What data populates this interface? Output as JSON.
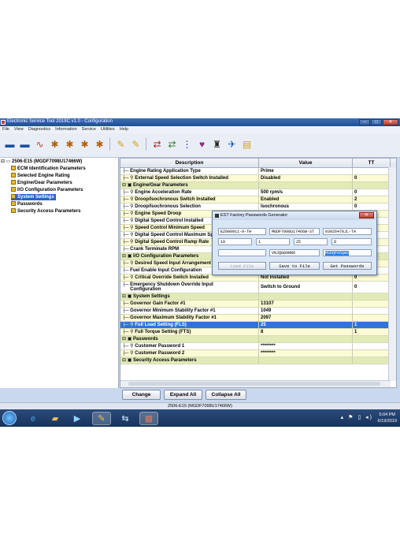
{
  "window": {
    "title": "Electronic Service Tool 2019C v1.0 - Configuration"
  },
  "menu": [
    "File",
    "View",
    "Diagnostics",
    "Information",
    "Service",
    "Utilities",
    "Help"
  ],
  "tree": [
    {
      "label": "2506-E15 (MGDF7098U17466W)",
      "level": 0
    },
    {
      "label": "ECM Identification Parameters",
      "level": 1
    },
    {
      "label": "Selected Engine Rating",
      "level": 1
    },
    {
      "label": "Engine/Gear Parameters",
      "level": 1
    },
    {
      "label": "I/O Configuration Parameters",
      "level": 1
    },
    {
      "label": "System Settings",
      "level": 1,
      "selected": true
    },
    {
      "label": "Passwords",
      "level": 1
    },
    {
      "label": "Security Access Parameters",
      "level": 1
    }
  ],
  "grid": {
    "headers": [
      "Description",
      "Value",
      "TT"
    ],
    "rows": [
      {
        "d": "Engine Rating Application Type",
        "v": "Prime",
        "t": "",
        "c": "w",
        "i": 1
      },
      {
        "d": "External Speed Selection Switch Installed",
        "v": "Disabled",
        "t": "0",
        "c": "y",
        "i": 2
      },
      {
        "d": "Engine/Gear Parameters",
        "v": "",
        "t": "",
        "c": "g",
        "i": 0
      },
      {
        "d": "Engine Acceleration Rate",
        "v": "500 rpm/s",
        "t": "0",
        "c": "w",
        "i": 2
      },
      {
        "d": "Droop/Isochronous Switch Installed",
        "v": "Enabled",
        "t": "2",
        "c": "y",
        "i": 2
      },
      {
        "d": "Droop/Isochronous Selection",
        "v": "Isochronous",
        "t": "0",
        "c": "w",
        "i": 2
      },
      {
        "d": "Engine Speed Droop",
        "v": "",
        "t": "",
        "c": "y",
        "i": 2
      },
      {
        "d": "Digital Speed Control Installed",
        "v": "",
        "t": "",
        "c": "w",
        "i": 2
      },
      {
        "d": "Speed Control Minimum Speed",
        "v": "",
        "t": "",
        "c": "y",
        "i": 2
      },
      {
        "d": "Digital Speed Control Maximum Speed",
        "v": "",
        "t": "",
        "c": "w",
        "i": 2
      },
      {
        "d": "Digital Speed Control Ramp Rate",
        "v": "",
        "t": "",
        "c": "y",
        "i": 2
      },
      {
        "d": "Crank Terminate RPM",
        "v": "",
        "t": "",
        "c": "w",
        "i": 1
      },
      {
        "d": "I/O Configuration Parameters",
        "v": "",
        "t": "",
        "c": "g",
        "i": 0
      },
      {
        "d": "Desired Speed Input Arrangement",
        "v": "",
        "t": "",
        "c": "y",
        "i": 2
      },
      {
        "d": "Fuel Enable Input Configuration",
        "v": "Switch to Ground",
        "t": "0",
        "c": "w",
        "i": 1
      },
      {
        "d": "Critical Override Switch Installed",
        "v": "Not Installed",
        "t": "0",
        "c": "y",
        "i": 2
      },
      {
        "d": "Emergency Shutdown Override Input Configuration",
        "v": "Switch to Ground",
        "t": "0",
        "c": "w",
        "i": 1,
        "tall": true
      },
      {
        "d": "System Settings",
        "v": "",
        "t": "",
        "c": "g",
        "i": 0
      },
      {
        "d": "Governor Gain Factor #1",
        "v": "13107",
        "t": "",
        "c": "y",
        "i": 1
      },
      {
        "d": "Governor Minimum Stability Factor #1",
        "v": "1049",
        "t": "",
        "c": "w",
        "i": 1
      },
      {
        "d": "Governor Maximum Stability Factor #1",
        "v": "2097",
        "t": "",
        "c": "y",
        "i": 1
      },
      {
        "d": "Full Load Setting (FLS)",
        "v": "25",
        "t": "1",
        "c": "s",
        "i": 2
      },
      {
        "d": "Full Torque Setting (FTS)",
        "v": "8",
        "t": "1",
        "c": "y",
        "i": 2
      },
      {
        "d": "Passwords",
        "v": "",
        "t": "",
        "c": "g",
        "i": 0
      },
      {
        "d": "Customer Password 1",
        "v": "********",
        "t": "",
        "c": "w",
        "i": 2
      },
      {
        "d": "Customer Password 2",
        "v": "********",
        "t": "",
        "c": "y",
        "i": 2
      },
      {
        "d": "Security Access Parameters",
        "v": "",
        "t": "",
        "c": "g",
        "i": 0
      }
    ]
  },
  "buttons": {
    "change": "Change",
    "expand": "Expand All",
    "collapse": "Collapse All"
  },
  "status": "2506-E15 (MGDF7098U17466W)",
  "dialog": {
    "title": "EST Factory Passwords Generator",
    "serial": "EZ000911-9-TH",
    "ecm": "MGDF7098U17466W-ST",
    "code3": "03926470JL-TA",
    "v1": "18",
    "v2": "1",
    "v3": "25",
    "v4": "8",
    "placeholder": "-----",
    "pw1": "VNJQG89NN6",
    "pw2": "MSDQPA5QWS",
    "load": "Load File",
    "save": "Save to File",
    "get": "Get Passwords"
  },
  "taskbar": {
    "time": "5:04 PM",
    "date": "6/19/2019"
  }
}
